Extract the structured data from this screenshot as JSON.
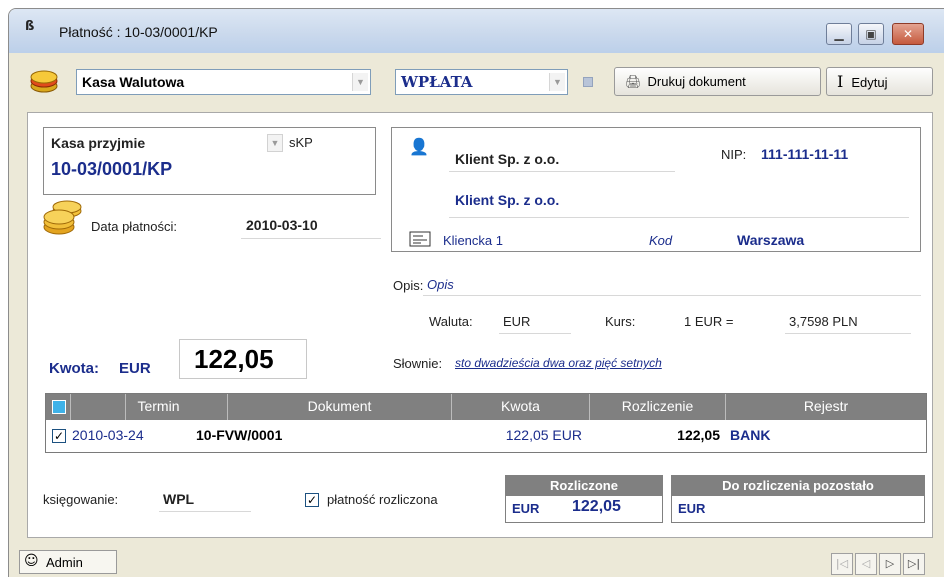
{
  "window": {
    "title": "Płatność : 10-03/0001/KP"
  },
  "toolbar": {
    "register_value": "Kasa Walutowa",
    "type_value": "WPŁATA",
    "print_label": "Drukuj dokument",
    "edit_label": "Edytuj"
  },
  "doc": {
    "kind_value": "Kasa przyjmie",
    "series_value": "sKP",
    "number": "10-03/0001/KP",
    "date_label": "Data płatności:",
    "date_value": "2010-03-10",
    "amount_label": "Kwota:",
    "currency": "EUR",
    "amount": "122,05"
  },
  "client": {
    "name": "Klient Sp. z o.o.",
    "nip_label": "NIP:",
    "nip": "111-111-11-11",
    "name2": "Klient Sp. z o.o.",
    "street": "Kliencka 1",
    "postal": "Kod",
    "city": "Warszawa"
  },
  "details": {
    "desc_label": "Opis:",
    "desc_value": "Opis",
    "currency_label": "Waluta:",
    "currency_value": "EUR",
    "rate_label": "Kurs:",
    "rate_left": "1 EUR =",
    "rate_right": "3,7598 PLN",
    "words_label": "Słownie:",
    "words_value": "sto dwadzieścia dwa oraz pięć setnych"
  },
  "grid": {
    "columns": [
      "Termin",
      "Dokument",
      "Kwota",
      "Rozliczenie",
      "Rejestr"
    ],
    "rows": [
      {
        "checked": true,
        "termin": "2010-03-24",
        "dokument": "10-FVW/0001",
        "kwota": "122,05 EUR",
        "rozliczenie": "122,05",
        "rejestr": "BANK"
      }
    ]
  },
  "footer": {
    "posting_label": "księgowanie:",
    "posting_value": "WPL",
    "settled_label": "płatność rozliczona",
    "settled_checked": true,
    "settled_box_title": "Rozliczone",
    "settled_currency": "EUR",
    "settled_amount": "122,05",
    "remaining_box_title": "Do rozliczenia pozostało",
    "remaining_currency": "EUR"
  },
  "status": {
    "user": "Admin"
  },
  "colors": {
    "accent_blue": "#1b2d8c",
    "grid_header": "#808080"
  }
}
